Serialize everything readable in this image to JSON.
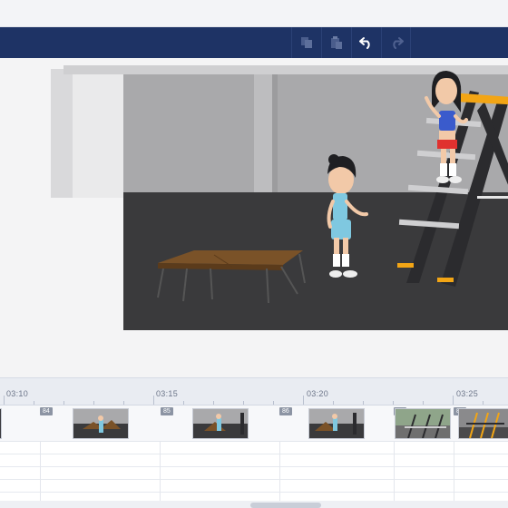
{
  "toolbar": {
    "buttons": [
      {
        "name": "copy",
        "icon": "copy-icon"
      },
      {
        "name": "paste",
        "icon": "paste-icon"
      },
      {
        "name": "undo",
        "icon": "undo-icon"
      },
      {
        "name": "redo",
        "icon": "redo-icon"
      }
    ],
    "background": "#1e3365"
  },
  "timeline": {
    "ruler_labels": [
      "03:10",
      "03:15",
      "03:20",
      "03:25"
    ],
    "scenes": [
      {
        "number": "84"
      },
      {
        "number": "85"
      },
      {
        "number": "86"
      },
      {
        "number": "87"
      },
      {
        "number": "88"
      }
    ]
  },
  "colors": {
    "toolbar": "#1e3365",
    "stage_floor": "#3a3a3c",
    "stage_wall": "#a9a9ab",
    "ladder_step": "#f2a515"
  }
}
